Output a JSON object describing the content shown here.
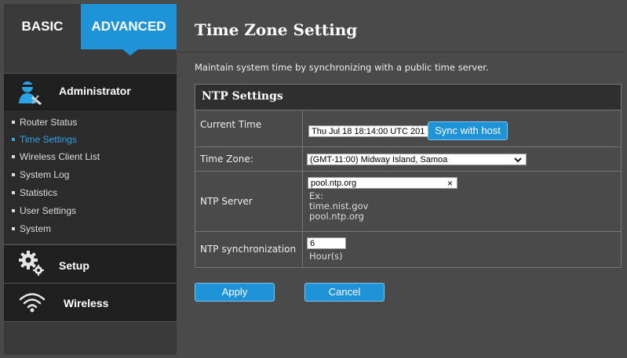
{
  "tabs": {
    "basic": "BASIC",
    "advanced": "ADVANCED"
  },
  "sidebar": {
    "admin_label": "Administrator",
    "items": [
      {
        "label": "Router Status",
        "active": false
      },
      {
        "label": "Time Settings",
        "active": true
      },
      {
        "label": "Wireless Client List",
        "active": false
      },
      {
        "label": "System Log",
        "active": false
      },
      {
        "label": "Statistics",
        "active": false
      },
      {
        "label": "User Settings",
        "active": false
      },
      {
        "label": "System",
        "active": false
      }
    ],
    "setup_label": "Setup",
    "wireless_label": "Wireless"
  },
  "page": {
    "title": "Time Zone Setting",
    "description": "Maintain system time by synchronizing with a public time server."
  },
  "ntp": {
    "section_title": "NTP Settings",
    "current_time_label": "Current Time",
    "current_time_value": "Thu Jul 18 18:14:00 UTC 201",
    "sync_button": "Sync with host",
    "time_zone_label": "Time Zone:",
    "time_zone_value": "(GMT-11:00) Midway Island, Samoa",
    "server_label": "NTP Server",
    "server_value": "pool.ntp.org",
    "server_clear": "×",
    "example_label": "Ex:",
    "example_1": "time.nist.gov",
    "example_2": "pool.ntp.org",
    "sync_label": "NTP synchronization",
    "sync_value": "6",
    "sync_unit": "Hour(s)"
  },
  "actions": {
    "apply": "Apply",
    "cancel": "Cancel"
  },
  "colors": {
    "accent": "#1f93d8",
    "active_link": "#2fa4e7"
  }
}
